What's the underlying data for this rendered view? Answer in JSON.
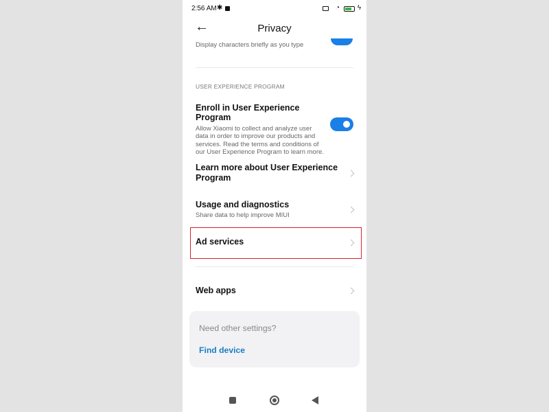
{
  "status": {
    "time": "2:56 AM"
  },
  "header": {
    "title": "Privacy",
    "back_icon": "arrow-left-icon"
  },
  "previous_item": {
    "description": "Display characters briefly as you type"
  },
  "section": {
    "header": "USER EXPERIENCE PROGRAM"
  },
  "enroll": {
    "title": "Enroll in User Experience Program",
    "description_lines": [
      "Allow Xiaomi to collect and analyze user",
      "data in order to improve our products and",
      "services. Read the terms and conditions of",
      "our User Experience Program to learn more."
    ],
    "toggle_on": true
  },
  "learn_more": {
    "title_lines": [
      "Learn more about User Experience",
      "Program"
    ]
  },
  "usage": {
    "title": "Usage and diagnostics",
    "description": "Share data to help improve MIUI"
  },
  "ad_services": {
    "title": "Ad services"
  },
  "web_apps": {
    "title": "Web apps"
  },
  "card": {
    "question": "Need other settings?",
    "link": "Find device"
  },
  "colors": {
    "accent": "#1a7fe6",
    "highlight": "#d81f2b",
    "link": "#1a7fc4"
  }
}
